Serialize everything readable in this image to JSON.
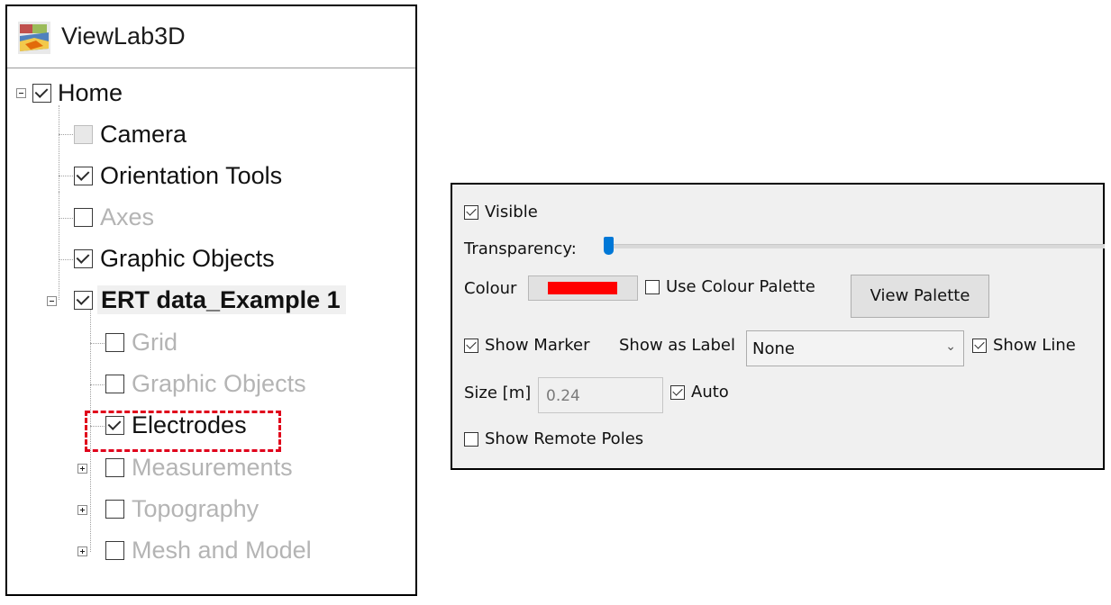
{
  "app": {
    "title": "ViewLab3D"
  },
  "tree": {
    "root": {
      "label": "Home",
      "checked": true
    },
    "items": [
      {
        "label": "Camera",
        "checked": false,
        "disabled": true
      },
      {
        "label": "Orientation Tools",
        "checked": true
      },
      {
        "label": "Axes",
        "checked": false
      },
      {
        "label": "Graphic Objects",
        "checked": true
      },
      {
        "label": "ERT data_Example 1",
        "checked": true,
        "bold": true
      },
      {
        "label": "Grid",
        "checked": false
      },
      {
        "label": "Graphic Objects",
        "checked": false
      },
      {
        "label": "Electrodes",
        "checked": true,
        "highlighted": true
      },
      {
        "label": "Measurements",
        "checked": false
      },
      {
        "label": "Topography",
        "checked": false
      },
      {
        "label": "Mesh and Model",
        "checked": false
      }
    ]
  },
  "properties": {
    "visible_label": "Visible",
    "transparency_label": "Transparency:",
    "transparency_value": 0,
    "colour_label": "Colour",
    "colour_value": "#ff0000",
    "use_colour_palette_label": "Use Colour Palette",
    "view_palette_label": "View Palette",
    "show_marker_label": "Show Marker",
    "show_as_label_label": "Show as Label",
    "show_as_label_value": "None",
    "show_line_label": "Show Line",
    "size_label": "Size [m]",
    "size_value": "0.24",
    "auto_label": "Auto",
    "show_remote_poles_label": "Show Remote Poles"
  },
  "colors": {
    "highlight": "#e0001b",
    "accent": "#0078d7"
  }
}
